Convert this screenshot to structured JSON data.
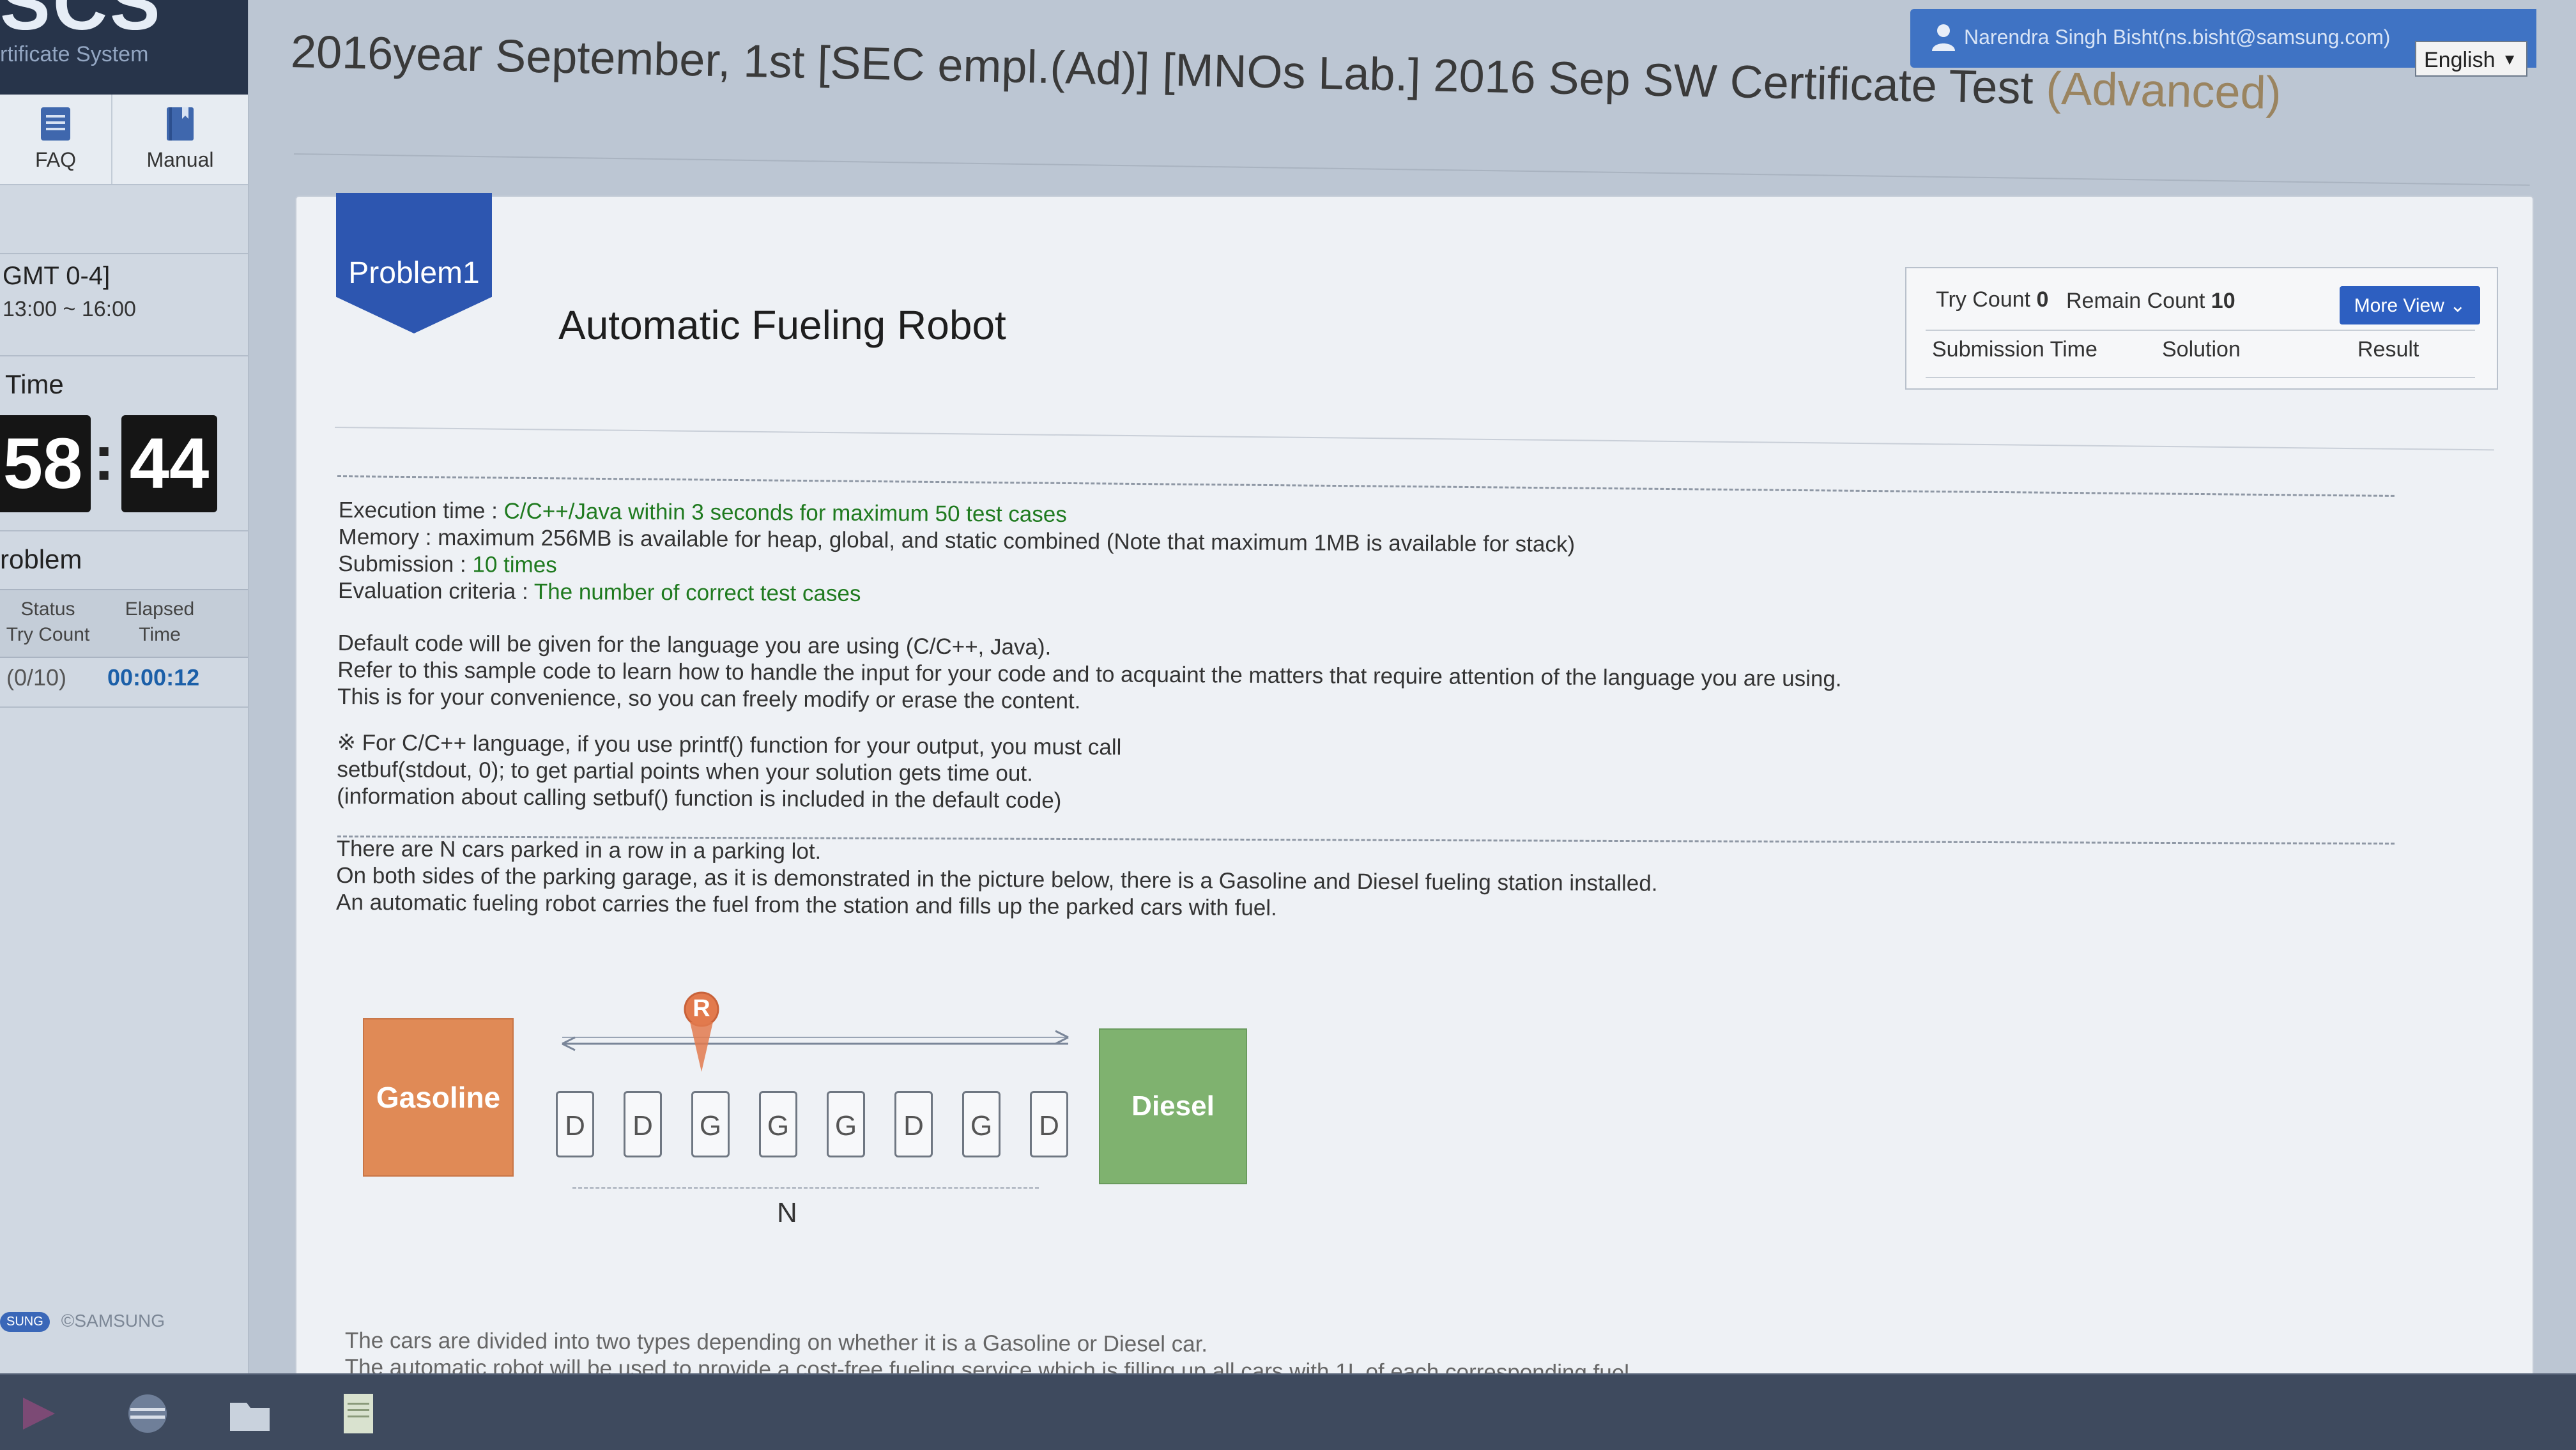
{
  "sidebar": {
    "brand_logo": "SCS",
    "brand_sub": "rtificate System",
    "quicklinks": {
      "faq": "FAQ",
      "manual": "Manual"
    },
    "timezone": "GMT 0-4]",
    "hours": "13:00 ~ 16:00",
    "time_label": "Time",
    "timer": {
      "minutes": "58",
      "seconds": "44"
    },
    "problem_label": "roblem",
    "problem_table": {
      "status_header": "Status\nTry Count",
      "elapsed_header": "Elapsed\nTime",
      "count": "(0/10)",
      "elapsed": "00:00:12"
    },
    "footer_chip": "SUNG",
    "footer_text": "©SAMSUNG"
  },
  "header": {
    "user": "Narendra Singh Bisht(ns.bisht@samsung.com)",
    "language": "English",
    "exam_title_main": "2016year September, 1st [SEC empl.(Ad)] [MNOs Lab.] 2016 Sep SW Certificate Test ",
    "exam_title_level": "(Advanced)"
  },
  "problem": {
    "badge": "Problem1",
    "title": "Automatic Fueling Robot",
    "try_count_label": "Try Count",
    "try_count": "0",
    "remain_count_label": "Remain Count",
    "remain_count": "10",
    "more_view": "More View",
    "columns": [
      "Submission Time",
      "Solution",
      "Result"
    ]
  },
  "content": {
    "exec_label": "Execution time : ",
    "exec_value": "C/C++/Java within 3 seconds for maximum 50 test cases",
    "memory": "Memory : maximum 256MB is available for heap, global, and static combined (Note that maximum 1MB is available for stack)",
    "submission_label": "Submission : ",
    "submission_value": "10 times",
    "eval_label": "Evaluation criteria : ",
    "eval_value": "The number of correct test cases",
    "default_code": [
      "Default code will be given for the language you are using (C/C++, Java).",
      "Refer to this sample code to learn how to handle the input for your code and to acquaint the matters that require attention of the language you are using.",
      "This is for your convenience, so you can freely modify or erase the content."
    ],
    "note": [
      "※ For C/C++ language, if you use printf() function for your output, you must call",
      "setbuf(stdout, 0); to get partial points when your solution gets time out.",
      "(information about calling setbuf() function is included in the default code)"
    ],
    "description": [
      "There are N cars parked in a row in a parking lot.",
      "On both sides of the parking garage, as it is demonstrated in the picture below, there is a Gasoline and Diesel fueling station installed.",
      "An automatic fueling robot carries the fuel from the station and fills up the parked cars with fuel."
    ],
    "bottom": [
      "The cars are divided into two types depending on whether it is a Gasoline or Diesel car.",
      "The automatic robot will be used to provide a cost-free fueling service which is filling up all cars with 1L of each corresponding fuel."
    ]
  },
  "diagram": {
    "gasoline": "Gasoline",
    "diesel": "Diesel",
    "robot": "R",
    "cars": [
      "D",
      "D",
      "G",
      "G",
      "G",
      "D",
      "G",
      "D"
    ],
    "n_label": "N"
  },
  "colors": {
    "accent": "#2d56b0",
    "gasoline": "#e08a56",
    "diesel": "#7fb26f",
    "highlight": "#1f7a1f"
  }
}
